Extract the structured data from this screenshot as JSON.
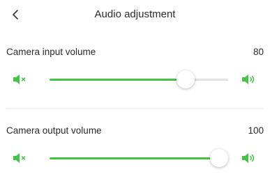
{
  "header": {
    "title": "Audio adjustment",
    "back_icon": "chevron-left-icon"
  },
  "colors": {
    "accent": "#44c444",
    "track": "#e2e2e2"
  },
  "sliders": [
    {
      "label": "Camera input volume",
      "value": "80",
      "level": 0.76,
      "mute_icon": "speaker-mute-icon",
      "volume_icon": "speaker-volume-icon"
    },
    {
      "label": "Camera output volume",
      "value": "100",
      "level": 0.95,
      "mute_icon": "speaker-mute-icon",
      "volume_icon": "speaker-volume-icon"
    }
  ]
}
